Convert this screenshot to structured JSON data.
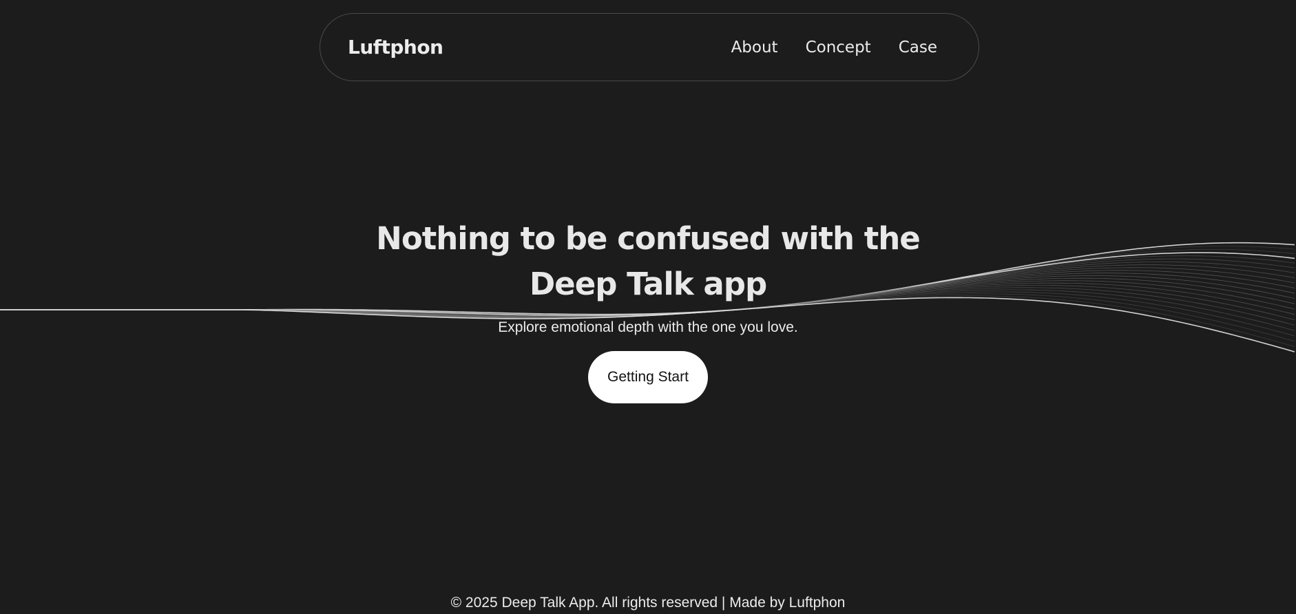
{
  "nav": {
    "brand": "Luftphon",
    "links": [
      "About",
      "Concept",
      "Case"
    ]
  },
  "hero": {
    "title_line1": "Nothing to be confused with the",
    "title_line2": "Deep Talk app",
    "subtitle": "Explore emotional depth with the one you love.",
    "cta_label": "Getting Start"
  },
  "footer": {
    "text": "© 2025 Deep Talk App. All rights reserved | Made by Luftphon"
  },
  "colors": {
    "background": "#1c1c1c",
    "text": "#ececec",
    "cta_background": "#ffffff",
    "cta_text": "#111111",
    "nav_border": "#4a4a4a"
  },
  "icons": [
    "wave-decoration"
  ]
}
